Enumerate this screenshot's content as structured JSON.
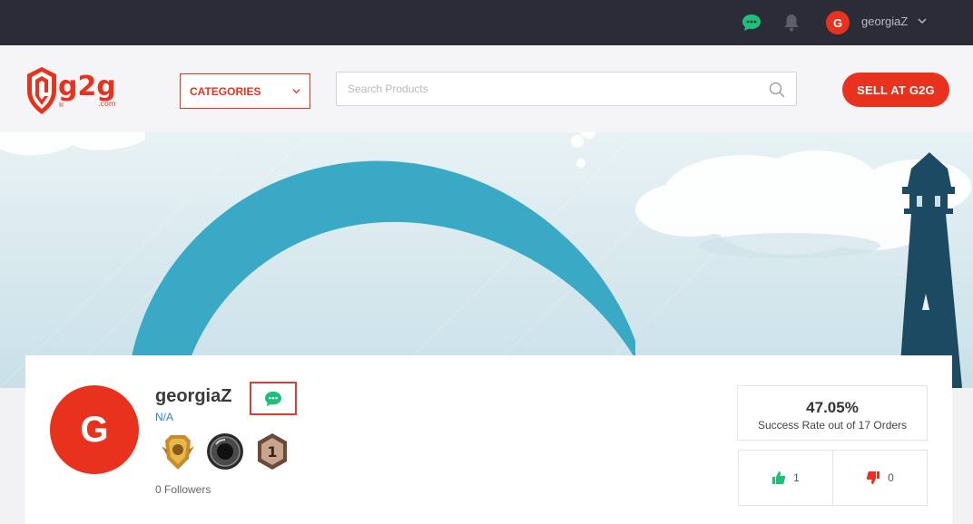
{
  "topbar": {
    "username": "georgiaZ",
    "avatar_letter": "G"
  },
  "header": {
    "logo_text": "g2g",
    "logo_sub": ".com",
    "categories_label": "CATEGORIES",
    "search_placeholder": "Search Products",
    "sell_label": "SELL AT G2G"
  },
  "profile": {
    "avatar_letter": "G",
    "name": "georgiaZ",
    "status": "N/A",
    "followers": "0 Followers",
    "success_rate": "47.05%",
    "success_label": "Success Rate out of 17 Orders",
    "positive": "1",
    "negative": "0"
  },
  "colors": {
    "brand_red": "#e8321e",
    "chat_green": "#1fbf7a",
    "topbar_bg": "#2c2c38"
  },
  "icons": [
    "chat-icon",
    "bell-icon",
    "chevron-down-icon",
    "search-icon",
    "thumbs-up-icon",
    "thumbs-down-icon"
  ]
}
